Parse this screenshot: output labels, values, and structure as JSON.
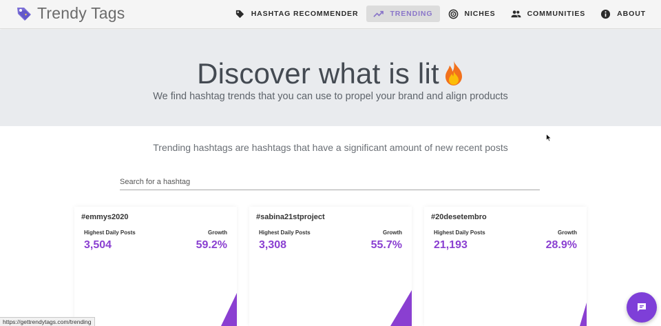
{
  "app": {
    "title": "Trendy Tags"
  },
  "nav": {
    "items": [
      {
        "label": "HASHTAG RECOMMENDER",
        "icon": "tag-icon",
        "active": false
      },
      {
        "label": "TRENDING",
        "icon": "trending-up-icon",
        "active": true
      },
      {
        "label": "NICHES",
        "icon": "target-icon",
        "active": false
      },
      {
        "label": "COMMUNITIES",
        "icon": "people-icon",
        "active": false
      },
      {
        "label": "ABOUT",
        "icon": "info-icon",
        "active": false
      }
    ]
  },
  "hero": {
    "title": "Discover what is lit",
    "subtitle": "We find hashtag trends that you can use to propel your brand and align products"
  },
  "intro": "Trending hashtags are hashtags that have a significant amount of new recent posts",
  "search": {
    "placeholder": "Search for a hashtag",
    "value": ""
  },
  "cards": [
    {
      "tag": "#emmys2020",
      "daily_label": "Highest Daily Posts",
      "daily_value": "3,504",
      "growth_label": "Growth",
      "growth_value": "59.2%"
    },
    {
      "tag": "#sabina21stproject",
      "daily_label": "Highest Daily Posts",
      "daily_value": "3,308",
      "growth_label": "Growth",
      "growth_value": "55.7%"
    },
    {
      "tag": "#20desetembro",
      "daily_label": "Highest Daily Posts",
      "daily_value": "21,193",
      "growth_label": "Growth",
      "growth_value": "28.9%"
    }
  ],
  "status_url": "https://gettrendytags.com/trending",
  "colors": {
    "accent": "#8a3fd1",
    "active_nav": "#8a76c9",
    "hero_bg": "#e9ebee",
    "chat": "#7e3fd8"
  }
}
